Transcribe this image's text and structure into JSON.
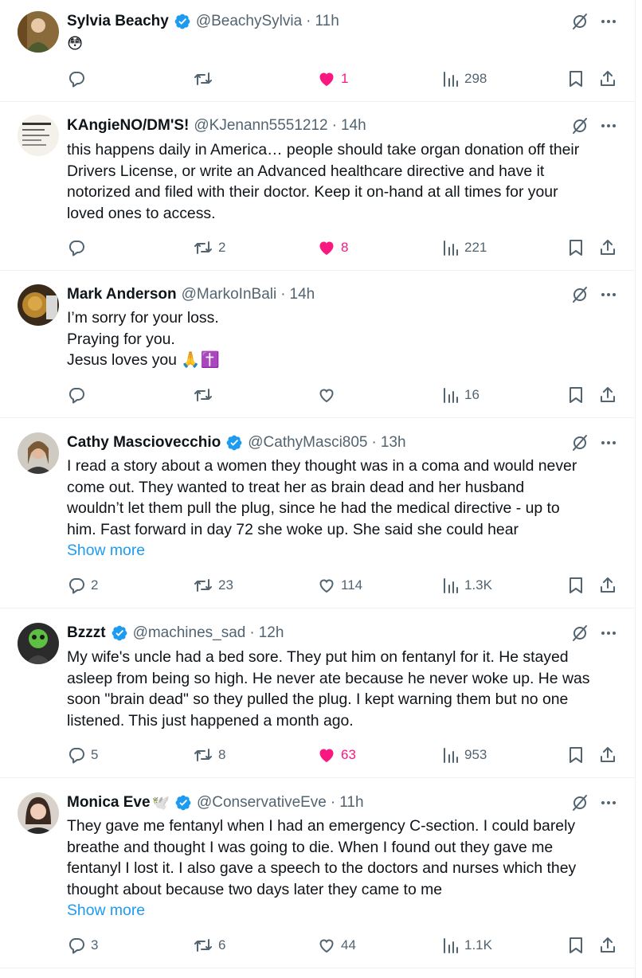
{
  "colors": {
    "accent": "#1d9bf0",
    "like": "#f91880",
    "muted": "#536471",
    "text": "#0f1419",
    "divider": "#eff3f4"
  },
  "icons": {
    "reply": "reply-icon",
    "retweet": "retweet-icon",
    "like": "heart-icon",
    "views": "views-icon",
    "bookmark": "bookmark-icon",
    "share": "share-icon",
    "grok": "grok-icon",
    "more": "more-icon",
    "verified": "verified-badge-icon"
  },
  "tweets": [
    {
      "name": "Sylvia Beachy",
      "handle": "@BeachySylvia",
      "sep": "·",
      "time": "11h",
      "verified": true,
      "text": [
        "😳"
      ],
      "reply_count": "",
      "retweet_count": "",
      "like_count": "1",
      "liked": true,
      "views": "298"
    },
    {
      "name": "KAngieNO/DM'S!",
      "handle": "@KJenann5551212",
      "sep": "·",
      "time": "14h",
      "verified": false,
      "text": [
        "this happens daily in America… people should take organ donation off their",
        "Drivers License, or write an Advanced healthcare directive and have it",
        "notorized and filed with their doctor. Keep it on-hand at all times for your",
        "loved ones to access."
      ],
      "reply_count": "",
      "retweet_count": "2",
      "like_count": "8",
      "liked": true,
      "views": "221"
    },
    {
      "name": "Mark Anderson",
      "handle": "@MarkoInBali",
      "sep": "·",
      "time": "14h",
      "verified": false,
      "text": [
        "I’m sorry for your loss.",
        "Praying for you.",
        "Jesus loves you 🙏✝️"
      ],
      "reply_count": "",
      "retweet_count": "",
      "like_count": "",
      "liked": false,
      "views": "16"
    },
    {
      "name": "Cathy Masciovecchio",
      "handle": "@CathyMasci805",
      "sep": "·",
      "time": "13h",
      "verified": true,
      "text": [
        "I read a story about a women they thought was in a coma and would never",
        "come out.  They wanted to treat her as brain dead and her husband",
        "wouldn’t let them pull the plug, since he had the medical directive - up to",
        "him.  Fast forward in day 72 she woke up.  She said she could hear"
      ],
      "show_more": "Show more",
      "reply_count": "2",
      "retweet_count": "23",
      "like_count": "114",
      "liked": false,
      "views": "1.3K"
    },
    {
      "name": "Bzzzt",
      "handle": "@machines_sad",
      "sep": "·",
      "time": "12h",
      "verified": true,
      "text": [
        "My wife's uncle had a bed sore. They put him on fentanyl for it. He stayed",
        "asleep from being so high. He never ate because he never woke up. He was",
        "soon \"brain dead\" so they pulled the plug. I kept warning them but no one",
        "listened. This just happened a month ago."
      ],
      "reply_count": "5",
      "retweet_count": "8",
      "like_count": "63",
      "liked": true,
      "views": "953"
    },
    {
      "name": "Monica Eve",
      "name_emoji": "🕊️",
      "handle": "@ConservativeEve",
      "sep": "·",
      "time": "11h",
      "verified": true,
      "text": [
        "They gave me fentanyl when I had an emergency C-section.  I could barely",
        "breathe and thought I was going to die.  When I found out they gave me",
        "fentanyl I lost it.   I also gave a speech to the doctors and nurses which they",
        "thought about because two days later they came to me"
      ],
      "show_more": "Show more",
      "reply_count": "3",
      "retweet_count": "6",
      "like_count": "44",
      "liked": false,
      "views": "1.1K"
    }
  ]
}
